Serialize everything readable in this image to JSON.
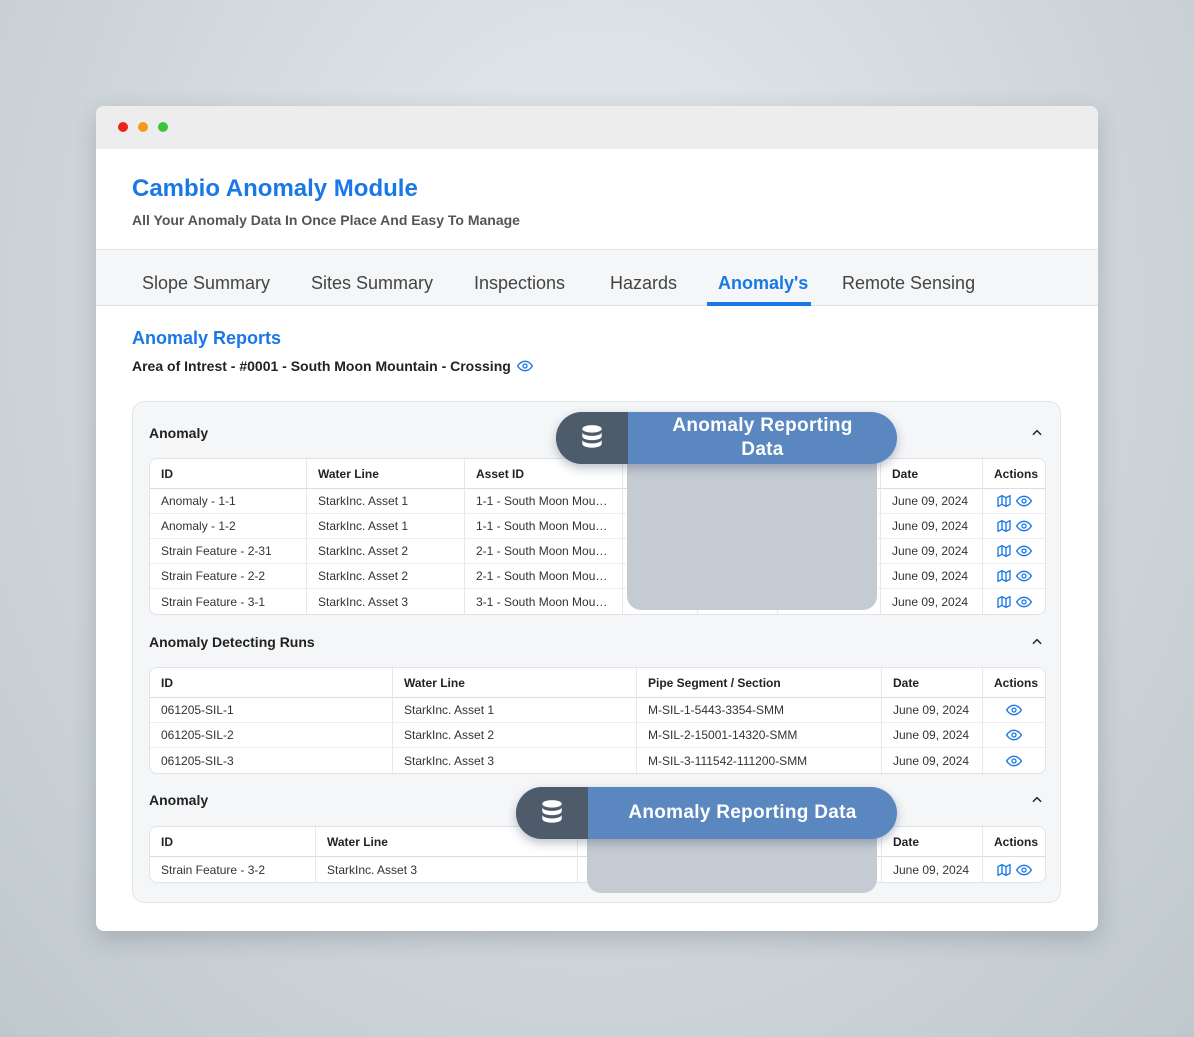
{
  "app": {
    "title": "Cambio Anomaly Module",
    "subtitle": "All Your Anomaly Data In Once Place And Easy To Manage"
  },
  "tabs": [
    {
      "label": "Slope Summary"
    },
    {
      "label": "Sites Summary"
    },
    {
      "label": "Inspections"
    },
    {
      "label": "Hazards"
    },
    {
      "label": "Anomaly's",
      "active": true
    },
    {
      "label": "Remote Sensing"
    }
  ],
  "reports": {
    "title": "Anomaly Reports",
    "area": "Area of Intrest - #0001 - South Moon Mountain - Crossing"
  },
  "anomaly_table": {
    "title": "Anomaly",
    "headers": {
      "id": "ID",
      "water_line": "Water Line",
      "asset_id": "Asset ID",
      "date": "Date",
      "actions": "Actions"
    },
    "rows": [
      {
        "id": "Anomaly - 1-1",
        "water_line": "StarkInc. Asset 1",
        "asset_id": "1-1 - South Moon Mountain",
        "date": "June 09, 2024"
      },
      {
        "id": "Anomaly - 1-2",
        "water_line": "StarkInc. Asset 1",
        "asset_id": "1-1 - South Moon Mountain",
        "date": "June 09, 2024"
      },
      {
        "id": "Strain Feature - 2-31",
        "water_line": "StarkInc. Asset 2",
        "asset_id": "2-1 - South Moon Mountain",
        "date": "June 09, 2024"
      },
      {
        "id": "Strain Feature - 2-2",
        "water_line": "StarkInc. Asset 2",
        "asset_id": "2-1 - South Moon Mountain",
        "date": "June 09, 2024"
      },
      {
        "id": "Strain Feature - 3-1",
        "water_line": "StarkInc. Asset 3",
        "asset_id": "3-1 - South Moon Mountain",
        "date": "June 09, 2024"
      }
    ]
  },
  "runs_table": {
    "title": "Anomaly Detecting Runs",
    "headers": {
      "id": "ID",
      "water_line": "Water Line",
      "segment": "Pipe Segment / Section",
      "date": "Date",
      "actions": "Actions"
    },
    "rows": [
      {
        "id": "061205-SIL-1",
        "water_line": "StarkInc. Asset 1",
        "segment": "M-SIL-1-5443-3354-SMM",
        "date": "June 09, 2024"
      },
      {
        "id": "061205-SIL-2",
        "water_line": "StarkInc. Asset 2",
        "segment": "M-SIL-2-15001-14320-SMM",
        "date": "June 09, 2024"
      },
      {
        "id": "061205-SIL-3",
        "water_line": "StarkInc. Asset 3",
        "segment": "M-SIL-3-111542-111200-SMM",
        "date": "June 09, 2024"
      }
    ]
  },
  "anomaly_table_2": {
    "title": "Anomaly",
    "headers": {
      "id": "ID",
      "water_line": "Water Line",
      "date": "Date",
      "actions": "Actions"
    },
    "rows": [
      {
        "id": "Strain Feature - 3-2",
        "water_line": "StarkInc. Asset 3",
        "date": "June 09, 2024"
      }
    ]
  },
  "callouts": {
    "first": "Anomaly Reporting Data",
    "second": "Anomaly Reporting Data"
  },
  "colors": {
    "accent": "#1a78e6",
    "pill": "#5a87c0",
    "pill_icon_bg": "#4e5b6b"
  }
}
